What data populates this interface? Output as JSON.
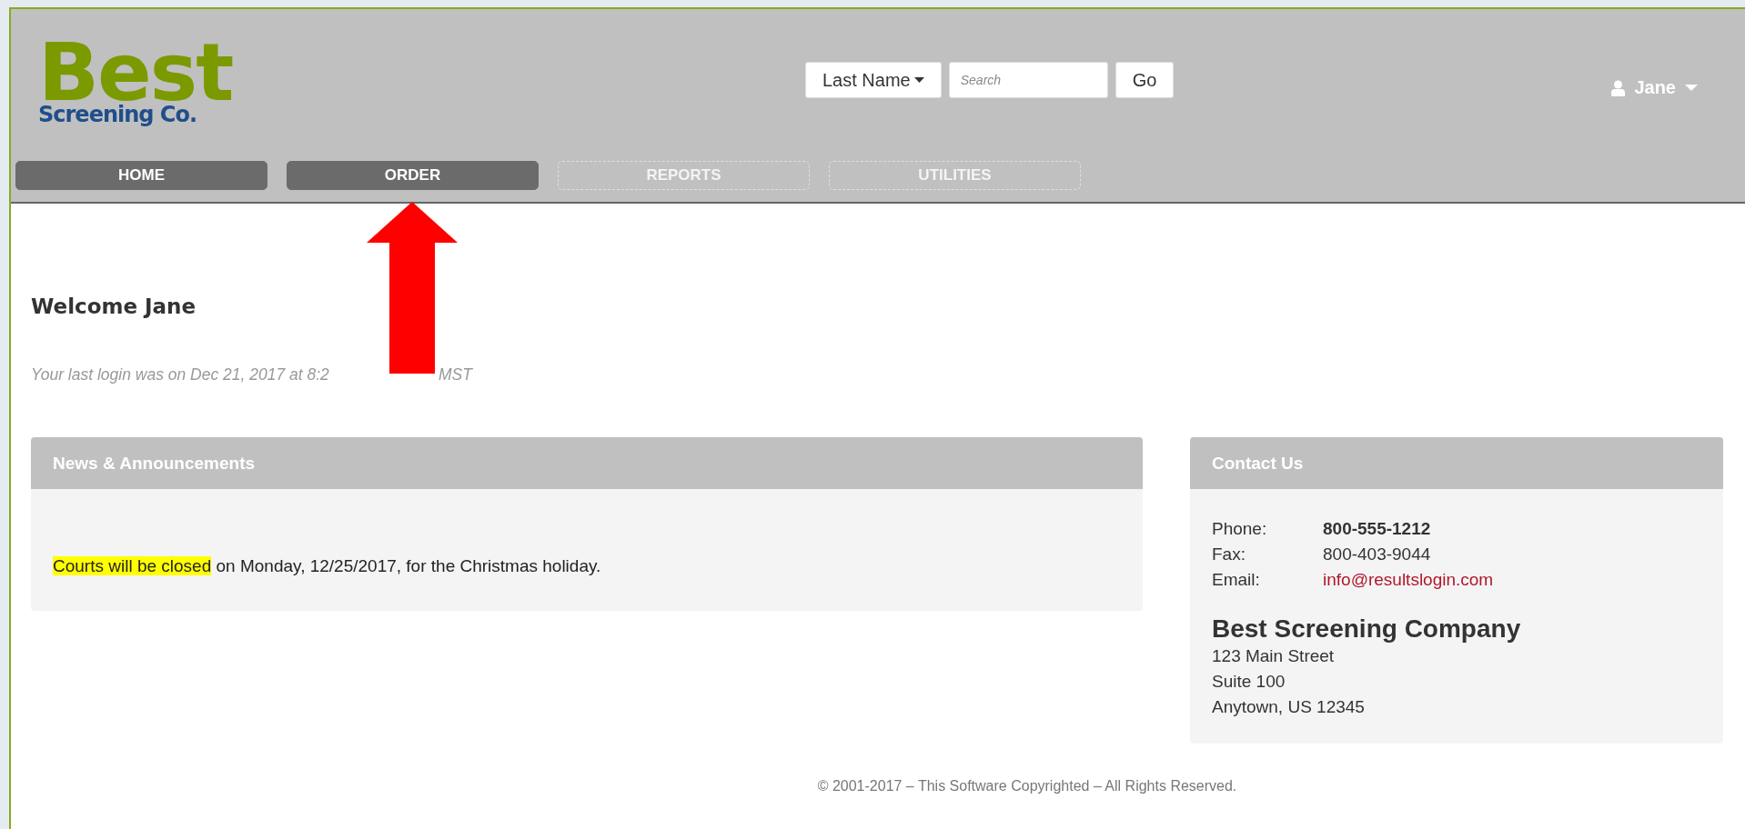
{
  "logo": {
    "brand": "Best",
    "sub": "Screening Co."
  },
  "search": {
    "field_menu": "Last Name",
    "placeholder": "Search",
    "go": "Go"
  },
  "user": {
    "name": "Jane"
  },
  "nav": [
    {
      "label": "HOME",
      "active": true
    },
    {
      "label": "ORDER",
      "active": true
    },
    {
      "label": "REPORTS",
      "active": false
    },
    {
      "label": "UTILITIES",
      "active": false
    }
  ],
  "welcome": {
    "title": "Welcome Jane",
    "last_login": "Your last login was on Dec 21, 2017 at 8:2",
    "last_login_tail": "MST"
  },
  "news": {
    "title": "News & Announcements",
    "items": [
      {
        "highlight": "Courts will be closed",
        "text": " on Monday, 12/25/2017, for the Christmas holiday."
      }
    ]
  },
  "contact": {
    "title": "Contact Us",
    "rows": [
      {
        "label": "Phone:",
        "value": "800-555-1212",
        "kind": "bold"
      },
      {
        "label": "Fax:",
        "value": "800-403-9044",
        "kind": "plain"
      },
      {
        "label": "Email:",
        "value": "info@resultslogin.com",
        "kind": "link"
      }
    ],
    "company": "Best Screening Company",
    "address": [
      "123 Main Street",
      "Suite 100",
      "Anytown, US 12345"
    ]
  },
  "footer": "© 2001-2017 – This Software Copyrighted – All Rights Reserved."
}
